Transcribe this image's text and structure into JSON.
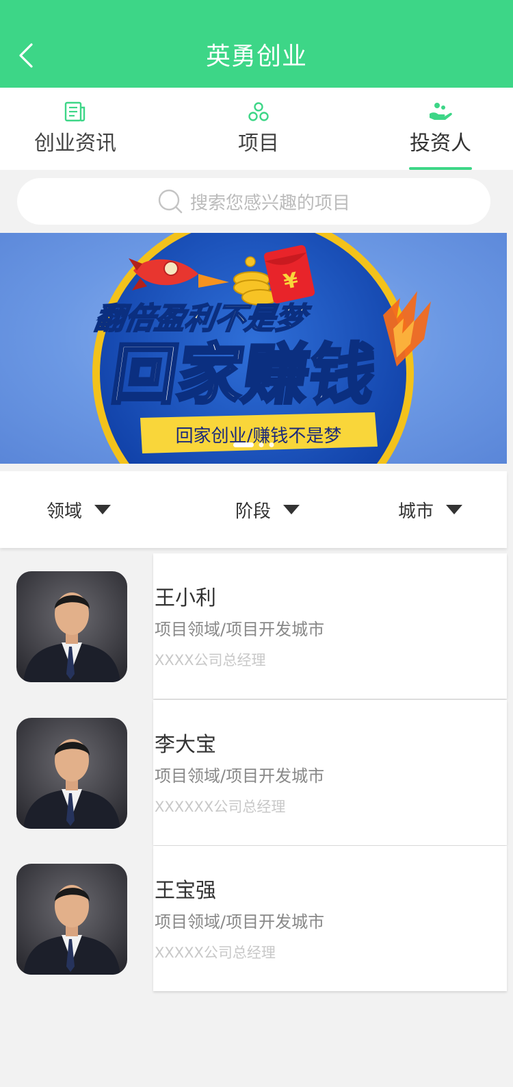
{
  "header": {
    "title": "英勇创业",
    "back_icon": "chevron-left-icon"
  },
  "tabs": [
    {
      "label": "创业资讯",
      "icon": "news-icon",
      "active": false
    },
    {
      "label": "项目",
      "icon": "project-icon",
      "active": false
    },
    {
      "label": "投资人",
      "icon": "investor-icon",
      "active": true
    }
  ],
  "search": {
    "placeholder": "搜索您感兴趣的项目",
    "icon": "search-icon"
  },
  "banner": {
    "headline_small": "翻倍盈利不是梦",
    "headline_big": "回家赚钱",
    "ribbon": "回家创业/赚钱不是梦",
    "envelope_symbol": "¥",
    "slide_count": 3,
    "active_slide": 1
  },
  "filters": [
    {
      "label": "领域"
    },
    {
      "label": "阶段"
    },
    {
      "label": "城市"
    }
  ],
  "investors": [
    {
      "name": "王小利",
      "field": "项目领域/项目开发城市",
      "company": "XXXX公司总经理"
    },
    {
      "name": "李大宝",
      "field": "项目领域/项目开发城市",
      "company": "XXXXXX公司总经理"
    },
    {
      "name": "王宝强",
      "field": "项目领域/项目开发城市",
      "company": "XXXXX公司总经理"
    }
  ],
  "colors": {
    "primary": "#3dd687",
    "background": "#f2f2f2",
    "banner_blue": "#6b98e4",
    "ribbon_yellow": "#f9d63a"
  }
}
